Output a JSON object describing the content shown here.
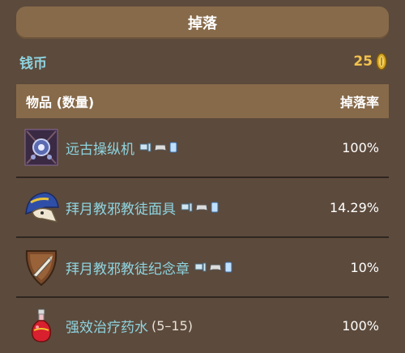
{
  "title": "掉落",
  "coins": {
    "label": "钱币",
    "value": "25",
    "icon": "gold-coin-icon"
  },
  "table": {
    "headers": {
      "item": "物品 (数量)",
      "rate": "掉落率"
    },
    "rows": [
      {
        "name": "远古操纵机",
        "qty": "",
        "rate": "100%",
        "icon": "ancient-manipulator-icon",
        "platforms": [
          "pc-icon",
          "gamepad-icon",
          "mobile-icon"
        ]
      },
      {
        "name": "拜月教邪教徒面具",
        "qty": "",
        "rate": "14.29%",
        "icon": "cultist-mask-icon",
        "platforms": [
          "pc-icon",
          "gamepad-icon",
          "mobile-icon"
        ]
      },
      {
        "name": "拜月教邪教徒纪念章",
        "qty": "",
        "rate": "10%",
        "icon": "cultist-relic-icon",
        "platforms": [
          "pc-icon",
          "gamepad-icon",
          "mobile-icon"
        ]
      },
      {
        "name": "强效治疗药水",
        "qty": "(5–15)",
        "rate": "100%",
        "icon": "healing-potion-icon",
        "platforms": []
      }
    ]
  },
  "colors": {
    "background": "#5c4a3c",
    "header": "#876a4a",
    "link": "#8ed4e0",
    "coin": "#f2c24c"
  }
}
